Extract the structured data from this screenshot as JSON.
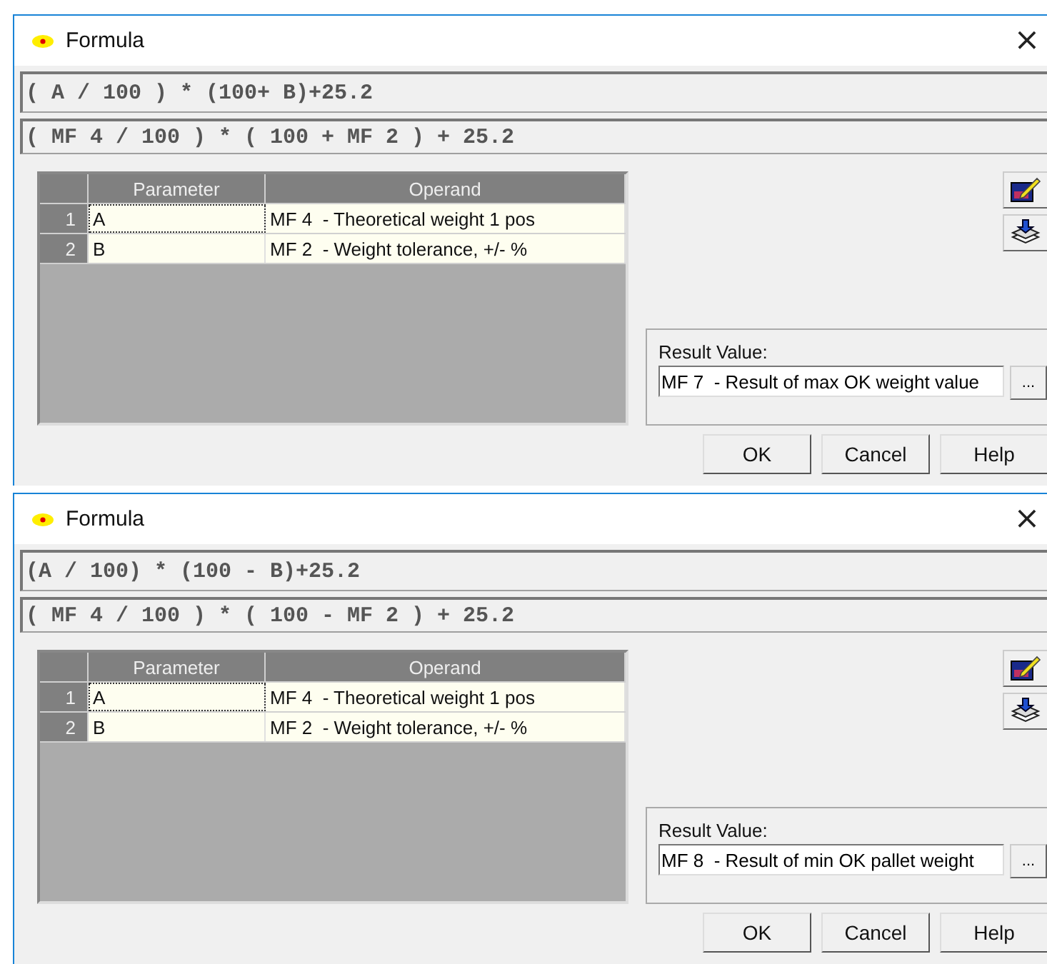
{
  "windows": [
    {
      "title": "Formula",
      "close": "×",
      "formula": "( A / 100 ) * (100+ B)+25.2",
      "expansion": "( MF 4 / 100 ) * ( 100 + MF 2 ) + 25.2",
      "table": {
        "columns": [
          "Parameter",
          "Operand"
        ],
        "rows": [
          {
            "number": "1",
            "parameter": "A",
            "operand": "MF 4  - Theoretical weight 1 pos",
            "focused": true
          },
          {
            "number": "2",
            "parameter": "B",
            "operand": "MF 2  - Weight tolerance, +/- %",
            "focused": false
          }
        ]
      },
      "result": {
        "label": "Result Value:",
        "value": "MF 7  - Result of max OK weight value",
        "browse": "..."
      },
      "buttons": [
        "OK",
        "Cancel",
        "Help"
      ]
    },
    {
      "title": "Formula",
      "close": "×",
      "formula": "(A / 100) * (100 - B)+25.2",
      "expansion": "( MF 4 / 100 ) * ( 100 - MF 2 ) + 25.2",
      "table": {
        "columns": [
          "Parameter",
          "Operand"
        ],
        "rows": [
          {
            "number": "1",
            "parameter": "A",
            "operand": "MF 4  - Theoretical weight 1 pos",
            "focused": true
          },
          {
            "number": "2",
            "parameter": "B",
            "operand": "MF 2  - Weight tolerance, +/- %",
            "focused": false
          }
        ]
      },
      "result": {
        "label": "Result Value:",
        "value": "MF 8  - Result of min OK pallet weight",
        "browse": "..."
      },
      "buttons": [
        "OK",
        "Cancel",
        "Help"
      ]
    }
  ]
}
